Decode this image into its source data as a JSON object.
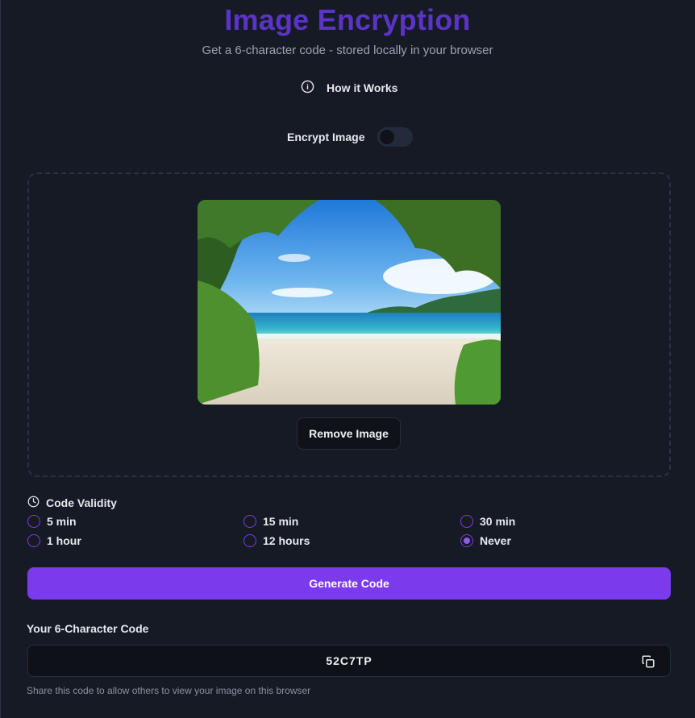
{
  "header": {
    "title": "Image Encryption",
    "subtitle": "Get a 6-character code - stored locally in your browser",
    "how_it_works_label": "How it Works"
  },
  "encrypt_toggle": {
    "label": "Encrypt Image",
    "enabled": false
  },
  "image_preview": {
    "remove_label": "Remove Image"
  },
  "validity": {
    "heading": "Code Validity",
    "options": [
      {
        "label": "5 min",
        "selected": false
      },
      {
        "label": "15 min",
        "selected": false
      },
      {
        "label": "30 min",
        "selected": false
      },
      {
        "label": "1 hour",
        "selected": false
      },
      {
        "label": "12 hours",
        "selected": false
      },
      {
        "label": "Never",
        "selected": true
      }
    ]
  },
  "generate_label": "Generate Code",
  "code_section": {
    "label": "Your 6-Character Code",
    "value": "52C7TP",
    "share_note": "Share this code to allow others to view your image on this browser"
  },
  "colors": {
    "accent": "#7c3aed",
    "title": "#5b34c6",
    "background": "#161a24"
  }
}
